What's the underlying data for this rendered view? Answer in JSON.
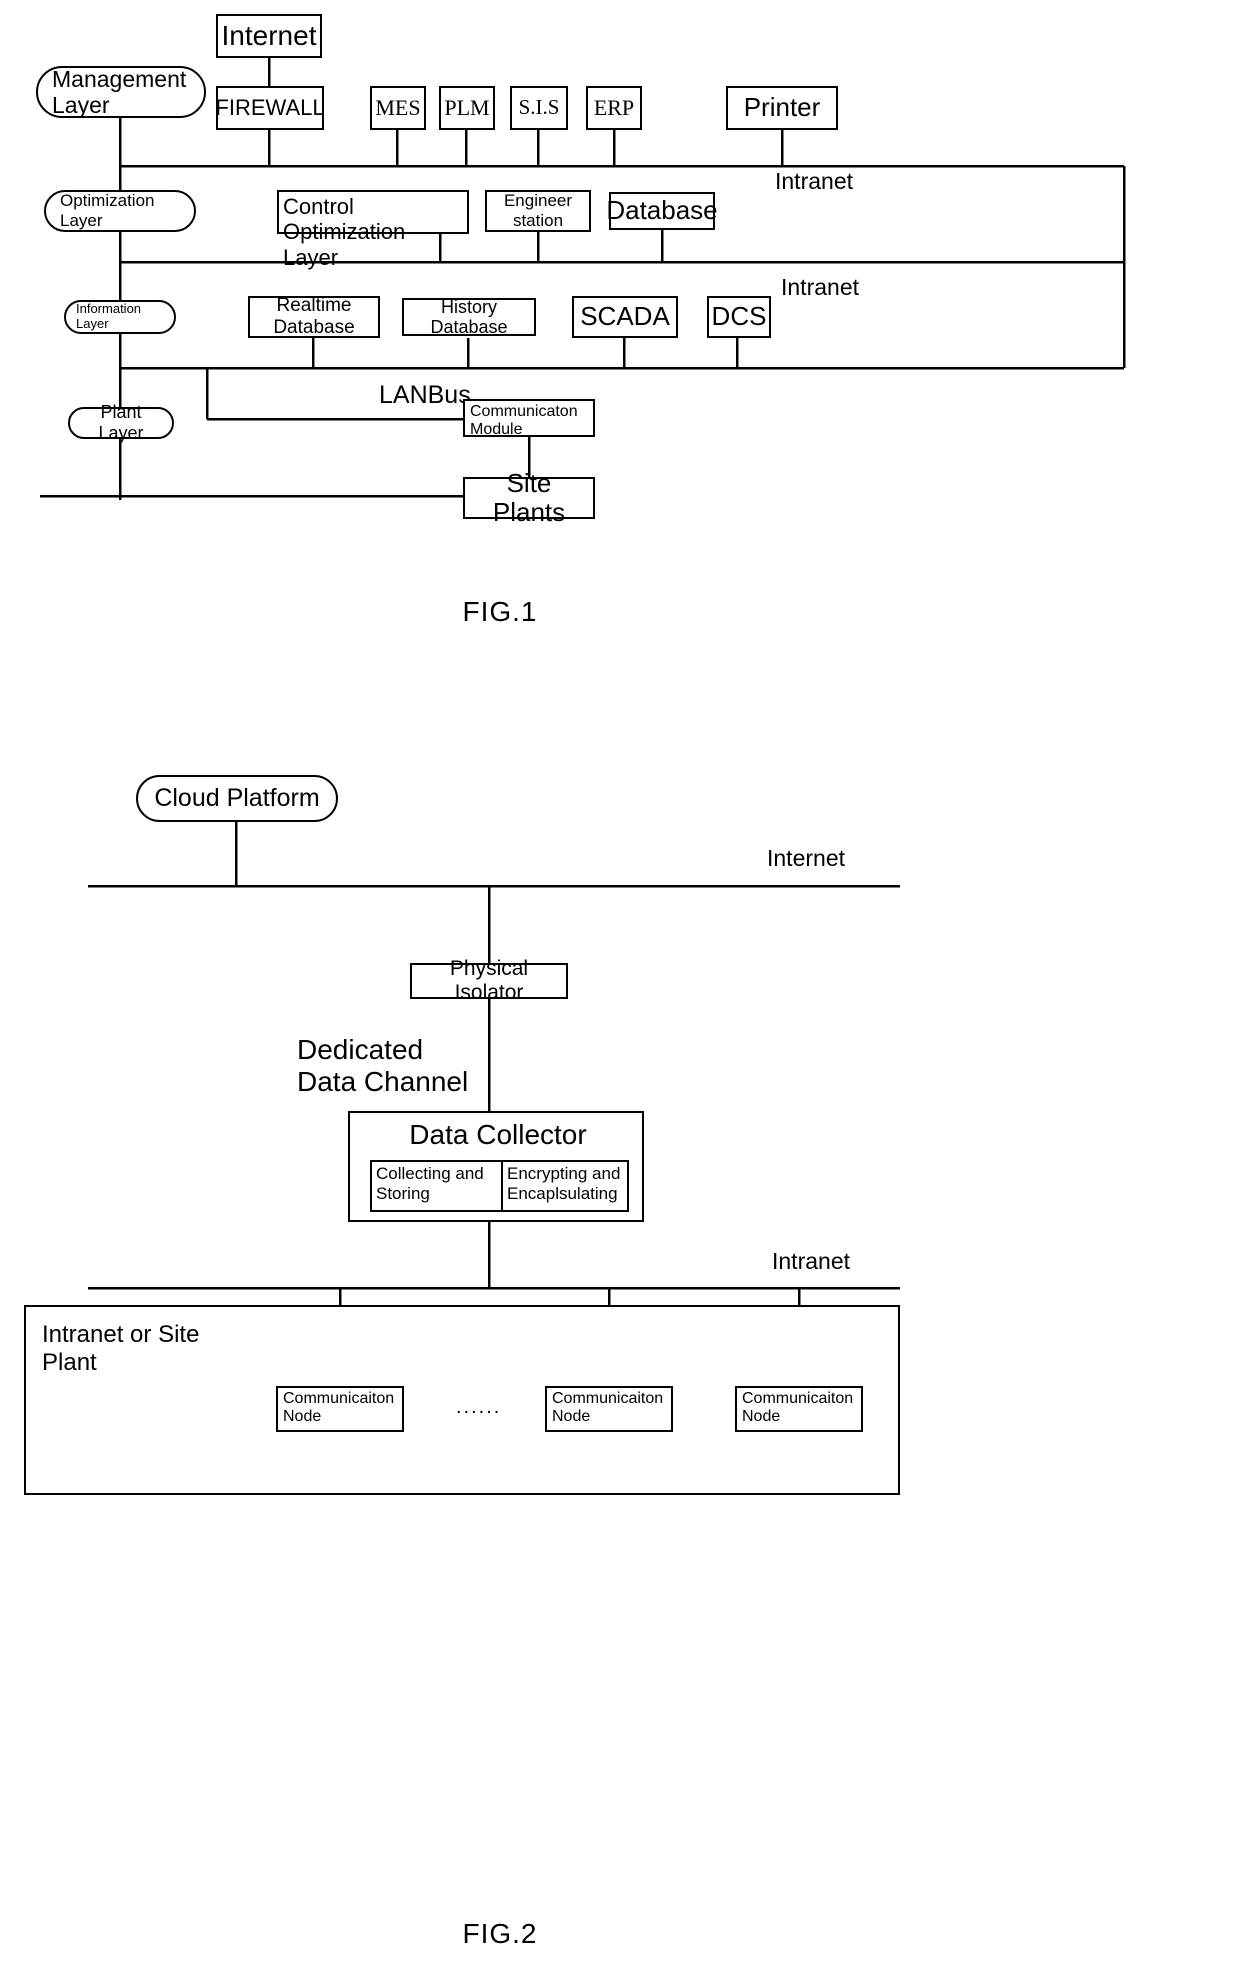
{
  "figures": [
    {
      "caption": "FIG.1",
      "layers": [
        {
          "label": "Management\nLayer"
        },
        {
          "label": "Optimization\nLayer"
        },
        {
          "label": "Information\nLayer"
        },
        {
          "label": "Plant Layer"
        }
      ],
      "nodes": {
        "internet": "Internet",
        "firewall": "FIREWALL",
        "mes": "MES",
        "plm": "PLM",
        "sis": "S.I.S",
        "erp": "ERP",
        "printer": "Printer",
        "control_optimization_layer": "Control Optimization\nLayer",
        "engineer_station": "Engineer\nstation",
        "database": "Database",
        "realtime_database": "Realtime\nDatabase",
        "history_database": "History Database",
        "scada": "SCADA",
        "dcs": "DCS",
        "communication_module": "Communicaton\nModule",
        "site_plants": "Site Plants"
      },
      "bus_labels": {
        "intranet_upper": "Intranet",
        "intranet_lower": "Intranet",
        "lanbus": "LANBus"
      }
    },
    {
      "caption": "FIG.2",
      "nodes": {
        "cloud_platform": "Cloud Platform",
        "physical_isolator": "Physical Isolator",
        "dedicated_data_channel": "Dedicated\nData Channel",
        "data_collector": "Data Collector",
        "collecting_and_storing": "Collecting and\nStoring",
        "encrypting_and_encapsulating": "Encrypting and\nEncaplsulating",
        "intranet_or_site_plant": "Intranet or Site\nPlant",
        "ellipsis": "......"
      },
      "bus_labels": {
        "internet": "Internet",
        "intranet": "Intranet"
      },
      "communication_nodes": [
        {
          "label": "Communicaiton\nNode"
        },
        {
          "label": "Communicaiton\nNode"
        },
        {
          "label": "Communicaiton\nNode"
        }
      ]
    }
  ],
  "colors": {
    "stroke": "#000000",
    "background": "#ffffff"
  }
}
